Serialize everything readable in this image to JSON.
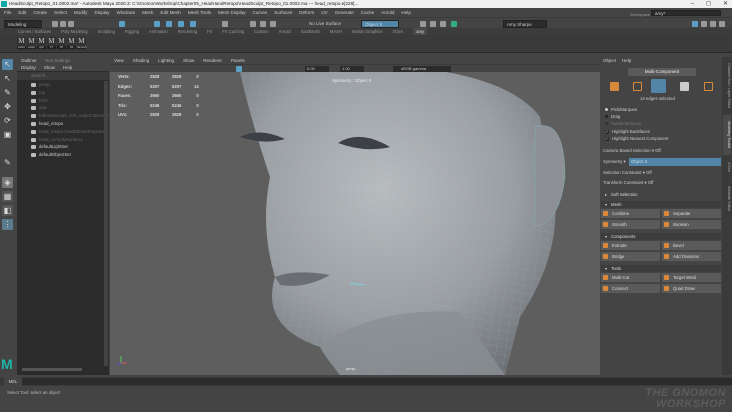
{
  "title_bar": {
    "text": "HeadSculpt_Retopo_01.0002.ma* - Autodesk Maya 2020.3: C:\\GnomonWorkshop\\Chapter05_HeadHandRetopo\\HeadSculpt_Retopo_01.0002.ma  ---  head_retopo.e[228]..."
  },
  "menu": [
    "File",
    "Edit",
    "Create",
    "Select",
    "Modify",
    "Display",
    "Windows",
    "Mesh",
    "Edit Mesh",
    "Mesh Tools",
    "Mesh Display",
    "Curves",
    "Surfaces",
    "Deform",
    "UV",
    "Generate",
    "Cache",
    "Arnold",
    "Help"
  ],
  "toolbar": {
    "menuset": "Modeling",
    "live_surface": "No Live Surface",
    "symmetry_field": "Object X",
    "user": "Amy Sharpe",
    "workspace_label": "Workspace :",
    "workspace": "amy*"
  },
  "shelf_tabs": [
    "Curves / Surfaces",
    "Poly Modeling",
    "Sculpting",
    "Rigging",
    "Animation",
    "Rendering",
    "FX",
    "FX Caching",
    "Custom",
    "Arnold",
    "GoZBrush",
    "MASH",
    "Motion Graphics",
    "XGen",
    "amy"
  ],
  "shelf_active": "amy",
  "shelf_items": [
    "ssdkm",
    "ssdplc",
    "spltr",
    "FT",
    "CP",
    "Dlt",
    "NamesS"
  ],
  "outliner": {
    "tabs": [
      "Outliner",
      "Tool Settings"
    ],
    "menu": [
      "Display",
      "Show",
      "Help"
    ],
    "search_placeholder": "Search...",
    "items": [
      {
        "name": "persp",
        "faded": true
      },
      {
        "name": "top",
        "faded": true
      },
      {
        "name": "front",
        "faded": true
      },
      {
        "name": "side",
        "faded": true
      },
      {
        "name": "fullHeadSculpt_006_scaled:ZBrushPolyMesh",
        "faded": true
      },
      {
        "name": "head_retopo",
        "faded": false
      },
      {
        "name": "head_retopo:headZBrushPolyMesh",
        "faded": true
      },
      {
        "name": "head_UV:polySurface1",
        "faded": true
      },
      {
        "name": "defaultLightSet",
        "faded": false
      },
      {
        "name": "defaultObjectSet",
        "faded": false
      }
    ]
  },
  "viewport": {
    "menu": [
      "View",
      "Shading",
      "Lighting",
      "Show",
      "Renderer",
      "Panels"
    ],
    "exposure": "0.00",
    "gamma": "1.00",
    "color_space": "sRGB gamma",
    "symmetry_label": "Symmetry : Object X",
    "camera": "persp",
    "hud": [
      {
        "label": "Verts:",
        "a": "2828",
        "b": "2828",
        "c": "0"
      },
      {
        "label": "Edges:",
        "a": "5297",
        "b": "5297",
        "c": "14"
      },
      {
        "label": "Faces:",
        "a": "2660",
        "b": "2660",
        "c": "0"
      },
      {
        "label": "Tris:",
        "a": "5246",
        "b": "5246",
        "c": "0"
      },
      {
        "label": "UVs:",
        "a": "2828",
        "b": "2828",
        "c": "0"
      }
    ]
  },
  "modeling_toolkit": {
    "menu": [
      "Object",
      "Help"
    ],
    "multi_component": "Multi-Component",
    "selection_info": "14 edges selected",
    "pick_marquee": "Pick/Marquee",
    "drag": "Drag",
    "tweak_marquee": "Tweak/Marquee",
    "highlight_backfaces": "Highlight Backfaces",
    "highlight_nearest": "Highlight Nearest Component",
    "camera_based": "Camera Based Selection",
    "camera_based_value": "Off",
    "symmetry": "Symmetry",
    "symmetry_value": "Object X",
    "selection_constraint": "Selection Constraint",
    "selection_constraint_value": "Off",
    "transform_constraint": "Transform Constraint",
    "transform_constraint_value": "Off",
    "soft_selection": "Soft Selection",
    "mesh": {
      "title": "Mesh",
      "buttons": [
        "Combine",
        "Separate",
        "Smooth",
        "Boolean"
      ]
    },
    "components": {
      "title": "Components",
      "buttons": [
        "Extrude",
        "Bevel",
        "Bridge",
        "Add Divisions"
      ]
    },
    "tools": {
      "title": "Tools",
      "buttons": [
        "Multi-Cut",
        "Target Weld",
        "Connect",
        "Quad Draw"
      ]
    }
  },
  "side_tabs": [
    "Channel Box / Layer Editor",
    "Modeling Toolkit",
    "XGen",
    "Attribute Editor"
  ],
  "command_line": {
    "language": "MEL"
  },
  "help_line": "Select Tool: select an object",
  "watermark": [
    "THE GNOMON",
    "WORKSHOP"
  ],
  "colors": {
    "accent": "#5285a6",
    "orange": "#d88a3a",
    "maya_logo": "#1fb5a8"
  }
}
